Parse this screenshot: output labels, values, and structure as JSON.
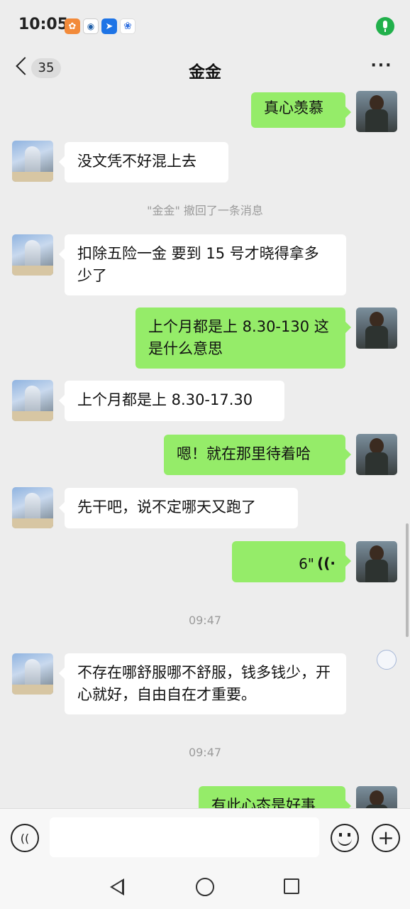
{
  "status_bar": {
    "time": "10:05",
    "notification_icons": [
      "pets-app-icon",
      "camera-app-icon",
      "map-app-icon",
      "baidu-paw-icon"
    ],
    "mic_indicator": "microphone-active-icon",
    "mic_color": "#21b04b"
  },
  "header": {
    "title": "金金",
    "unread_count": "35",
    "more_label": "···"
  },
  "messages": [
    {
      "side": "out",
      "text": "真心羡慕"
    },
    {
      "side": "in",
      "text": "没文凭不好混上去"
    },
    {
      "type": "system",
      "text": "\"金金\" 撤回了一条消息"
    },
    {
      "side": "in",
      "text": "扣除五险一金 要到 15 号才晓得拿多少了"
    },
    {
      "side": "out",
      "text": " 上个月都是上 8.30-130 这是什么意思"
    },
    {
      "side": "in",
      "text": "上个月都是上 8.30-17.30"
    },
    {
      "side": "out",
      "text": "嗯！就在那里待着哈"
    },
    {
      "side": "in",
      "text": "先干吧，说不定哪天又跑了"
    },
    {
      "side": "out",
      "type": "voice",
      "duration": "6\""
    },
    {
      "type": "time",
      "text": "09:47"
    },
    {
      "side": "in",
      "text": " 不存在哪舒服哪不舒服，钱多钱少，开心就好，自由自在才重要。"
    },
    {
      "type": "time",
      "text": "09:47"
    },
    {
      "side": "out",
      "text": "有此心态是好事"
    }
  ],
  "colors": {
    "background": "#ededed",
    "outgoing_bubble": "#95ec69",
    "incoming_bubble": "#ffffff"
  },
  "input_bar": {
    "input_value": "",
    "voice_icon": "voice-input-icon",
    "emoji_icon": "emoji-icon",
    "plus_icon": "plus-icon",
    "voice_glyph": "((",
    "plus_glyph": "+"
  },
  "nav_bar": {
    "icons": [
      "nav-back-icon",
      "nav-home-icon",
      "nav-recent-icon"
    ]
  }
}
